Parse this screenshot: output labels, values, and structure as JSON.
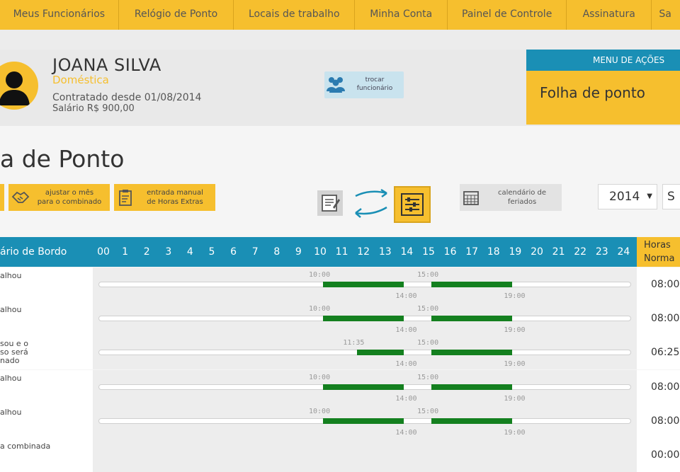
{
  "nav": {
    "items": [
      {
        "label": "Meus Funcionários"
      },
      {
        "label": "Relógio de Ponto"
      },
      {
        "label": "Locais de trabalho"
      },
      {
        "label": "Minha Conta"
      },
      {
        "label": "Painel de Controle"
      },
      {
        "label": "Assinatura"
      },
      {
        "label": "Sa"
      }
    ]
  },
  "employee": {
    "name": "JOANA SILVA",
    "role": "Doméstica",
    "hired": "Contratado desde 01/08/2014",
    "salary": "Salário R$ 900,00"
  },
  "swap_button": {
    "label_line1": "trocar",
    "label_line2": "funcionário",
    "icon": "group-icon"
  },
  "actions_menu": {
    "header": "MENU DE AÇÕES",
    "item": "Folha de ponto"
  },
  "page": {
    "title": "a de Ponto"
  },
  "toolbar": {
    "adjust": {
      "line1": "ajustar o mês",
      "line2": "para o combinado",
      "icon": "handshake-icon"
    },
    "manual": {
      "line1": "entrada manual",
      "line2": "de Horas Extras",
      "icon": "clipboard-icon"
    },
    "view_toggle": {
      "icons": [
        "edit-sheet-icon",
        "swap-arrows-icon",
        "list-view-icon"
      ]
    },
    "holidays": {
      "line1": "calendário de",
      "line2": "feriados",
      "icon": "calendar-icon"
    },
    "year": "2014",
    "month": "S"
  },
  "colors": {
    "accent": "#f6bf2e",
    "header_blue": "#1a8fb5",
    "bar_green": "#14801f"
  },
  "table": {
    "left_header": "ário de Bordo",
    "hours": [
      "00",
      "1",
      "2",
      "3",
      "4",
      "5",
      "6",
      "7",
      "8",
      "9",
      "10",
      "11",
      "12",
      "13",
      "14",
      "15",
      "16",
      "17",
      "18",
      "19",
      "20",
      "21",
      "22",
      "23",
      "24"
    ],
    "right_header": {
      "line1": "Horas",
      "line2": "Norma"
    },
    "rows": [
      {
        "note": [
          "alhou"
        ],
        "total": "08:00",
        "in1": "10:00",
        "out1": "14:00",
        "in2": "15:00",
        "out2": "19:00",
        "in1_h": 10,
        "out1_h": 14,
        "in2_h": 15,
        "out2_h": 19
      },
      {
        "note": [
          "alhou"
        ],
        "total": "08:00",
        "in1": "10:00",
        "out1": "14:00",
        "in2": "15:00",
        "out2": "19:00",
        "in1_h": 10,
        "out1_h": 14,
        "in2_h": 15,
        "out2_h": 19
      },
      {
        "note": [
          "sou e o",
          "so será",
          "nado"
        ],
        "total": "06:25",
        "in1": "11:35",
        "out1": "14:00",
        "in2": "15:00",
        "out2": "19:00",
        "in1_h": 11.58,
        "out1_h": 14,
        "in2_h": 15,
        "out2_h": 19
      },
      {
        "note": [
          "alhou"
        ],
        "total": "08:00",
        "in1": "10:00",
        "out1": "14:00",
        "in2": "15:00",
        "out2": "19:00",
        "in1_h": 10,
        "out1_h": 14,
        "in2_h": 15,
        "out2_h": 19
      },
      {
        "note": [
          "alhou"
        ],
        "total": "08:00",
        "in1": "10:00",
        "out1": "14:00",
        "in2": "15:00",
        "out2": "19:00",
        "in1_h": 10,
        "out1_h": 14,
        "in2_h": 15,
        "out2_h": 19
      },
      {
        "note": [
          "a combinada"
        ],
        "total": "00:00",
        "in1": "",
        "out1": "",
        "in2": "",
        "out2": ""
      }
    ]
  }
}
